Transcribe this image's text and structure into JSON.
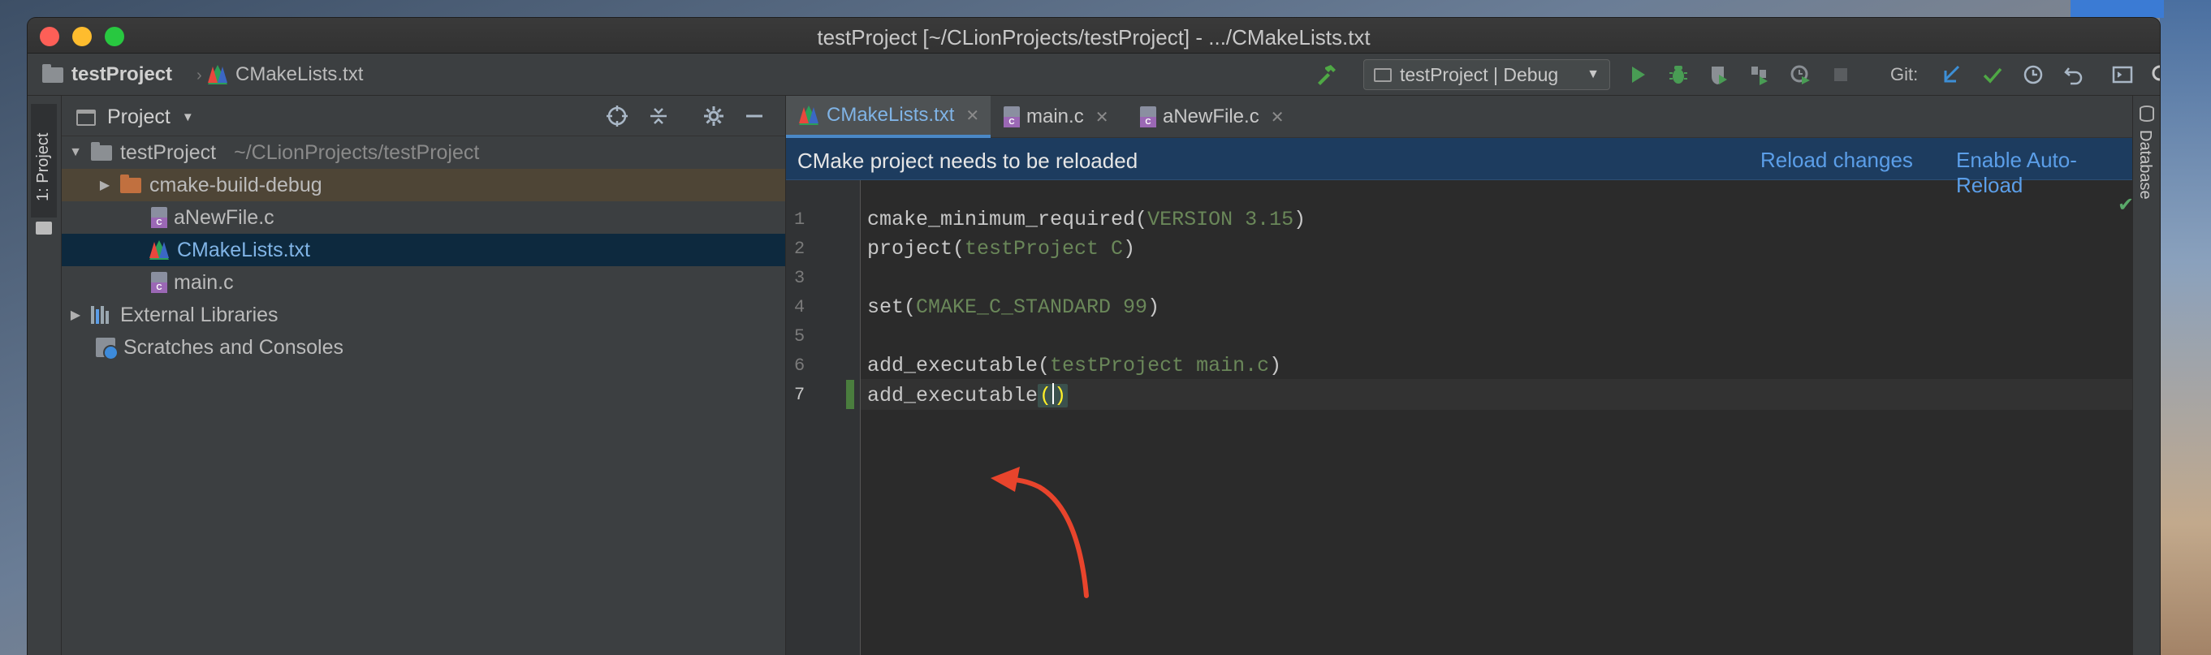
{
  "window": {
    "title": "testProject [~/CLionProjects/testProject] - .../CMakeLists.txt"
  },
  "navbar": {
    "project": "testProject",
    "file": "CMakeLists.txt",
    "run_config": "testProject | Debug",
    "git_label": "Git:"
  },
  "sidebar": {
    "tool_tab": "1: Project"
  },
  "project_panel": {
    "title": "Project",
    "tree": [
      {
        "label": "testProject",
        "path": "~/CLionProjects/testProject"
      },
      {
        "label": "cmake-build-debug"
      },
      {
        "label": "aNewFile.c"
      },
      {
        "label": "CMakeLists.txt"
      },
      {
        "label": "main.c"
      },
      {
        "label": "External Libraries"
      },
      {
        "label": "Scratches and Consoles"
      }
    ]
  },
  "tabs": [
    {
      "label": "CMakeLists.txt"
    },
    {
      "label": "main.c"
    },
    {
      "label": "aNewFile.c"
    }
  ],
  "notification": {
    "message": "CMake project needs to be reloaded",
    "reload": "Reload changes",
    "auto_reload": "Enable Auto-Reload"
  },
  "editor": {
    "line_numbers": [
      "1",
      "2",
      "3",
      "4",
      "5",
      "6",
      "7"
    ],
    "lines": [
      {
        "fn": "cmake_minimum_required(",
        "arg": "VERSION 3.15",
        "end": ")"
      },
      {
        "fn": "project(",
        "arg": "testProject C",
        "end": ")"
      },
      {
        "fn": "",
        "arg": "",
        "end": ""
      },
      {
        "fn": "set(",
        "arg": "CMAKE_C_STANDARD 99",
        "end": ")"
      },
      {
        "fn": "",
        "arg": "",
        "end": ""
      },
      {
        "fn": "add_executable(",
        "arg": "testProject main.c",
        "end": ")"
      },
      {
        "fn": "add_executable",
        "open": "(",
        "close": ")"
      }
    ]
  },
  "right_strip": {
    "label": "Database"
  },
  "colors": {
    "accent": "#4a88c7",
    "annotation_arrow": "#e8442c",
    "string_arg": "#6a8759",
    "notify_bg": "#1d3c5f"
  }
}
